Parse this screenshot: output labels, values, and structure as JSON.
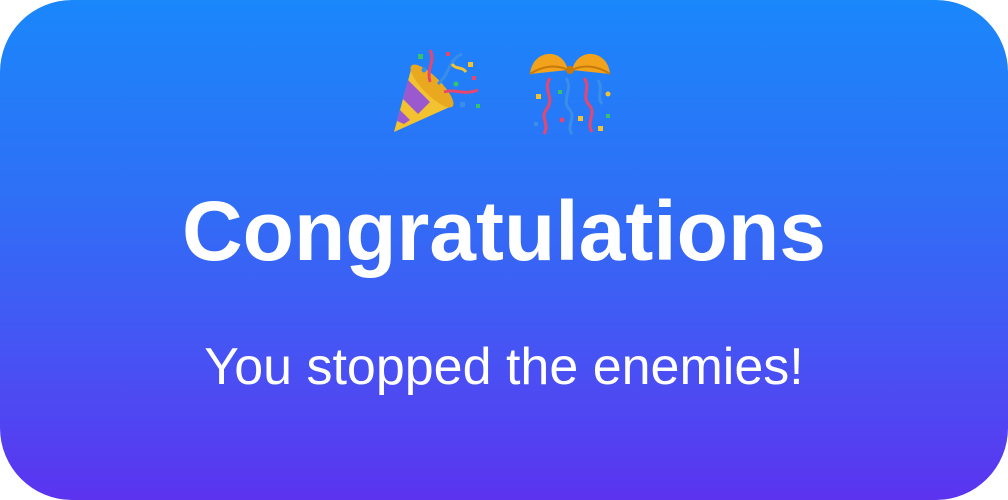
{
  "dialog": {
    "title": "Congratulations",
    "message": "You stopped the enemies!",
    "icons": [
      "party-popper-icon",
      "confetti-ball-icon"
    ],
    "colors": {
      "gradient_top": "#1a87fb",
      "gradient_bottom": "#5b33ef",
      "text": "#ffffff"
    }
  }
}
